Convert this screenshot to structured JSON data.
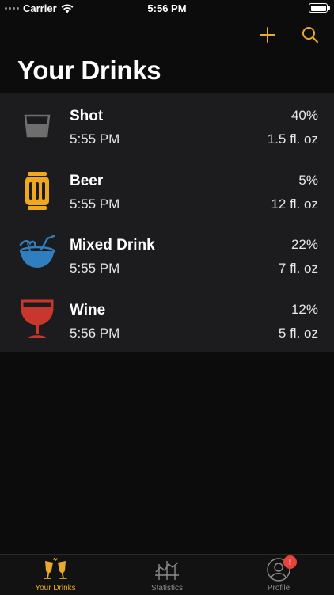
{
  "status_bar": {
    "carrier": "Carrier",
    "time": "5:56 PM"
  },
  "nav": {
    "title": "Your Drinks",
    "add_icon": "plus-icon",
    "search_icon": "search-icon"
  },
  "colors": {
    "accent": "#e9a92a",
    "beer": "#f0a81e",
    "mixed": "#2f7fc0",
    "wine": "#c8372d",
    "shot": "#6e6e6e",
    "badge": "#e5443a"
  },
  "drinks": [
    {
      "name": "Shot",
      "time": "5:55 PM",
      "abv": "40%",
      "volume": "1.5 fl. oz",
      "icon": "shot-glass-icon"
    },
    {
      "name": "Beer",
      "time": "5:55 PM",
      "abv": "5%",
      "volume": "12 fl. oz",
      "icon": "beer-can-icon"
    },
    {
      "name": "Mixed Drink",
      "time": "5:55 PM",
      "abv": "22%",
      "volume": "7 fl. oz",
      "icon": "coconut-drink-icon"
    },
    {
      "name": "Wine",
      "time": "5:56 PM",
      "abv": "12%",
      "volume": "5 fl. oz",
      "icon": "wine-glass-icon"
    }
  ],
  "tabs": [
    {
      "label": "Your Drinks",
      "icon": "cheers-icon",
      "active": true
    },
    {
      "label": "Statistics",
      "icon": "chart-icon",
      "active": false
    },
    {
      "label": "Profile",
      "icon": "profile-icon",
      "active": false,
      "badge": "!"
    }
  ]
}
